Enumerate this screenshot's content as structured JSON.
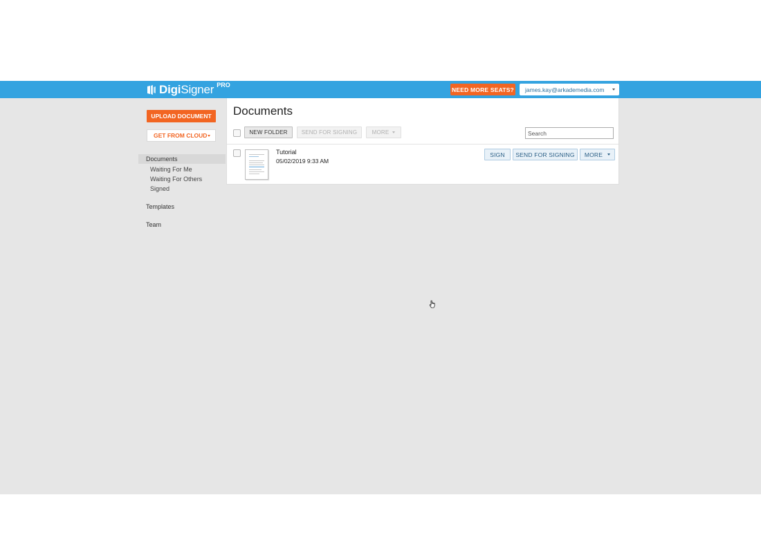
{
  "brand": {
    "name_strong": "Digi",
    "name_light": "Signer",
    "badge": "PRO",
    "color": "#34a3e0"
  },
  "header": {
    "seats_label": "NEED MORE SEATS?",
    "account_email": "james.kay@arkademedia.com",
    "accent_color": "#f26522"
  },
  "sidebar": {
    "upload_label": "UPLOAD DOCUMENT",
    "cloud_label": "GET FROM CLOUD",
    "nav": {
      "documents": "Documents",
      "waiting_me": "Waiting For Me",
      "waiting_others": "Waiting For Others",
      "signed": "Signed",
      "templates": "Templates",
      "team": "Team"
    }
  },
  "main": {
    "title": "Documents",
    "toolbar": {
      "new_folder": "NEW FOLDER",
      "send_for_signing": "SEND FOR SIGNING",
      "more": "MORE",
      "search_placeholder": "Search"
    },
    "documents": [
      {
        "name": "Tutorial",
        "date": "05/02/2019 9:33 AM",
        "actions": {
          "sign": "SIGN",
          "send": "SEND FOR SIGNING",
          "more": "MORE"
        }
      }
    ]
  },
  "icons": {
    "logo": "digisigner-logo-icon",
    "cursor": "hand-pointer-icon"
  }
}
